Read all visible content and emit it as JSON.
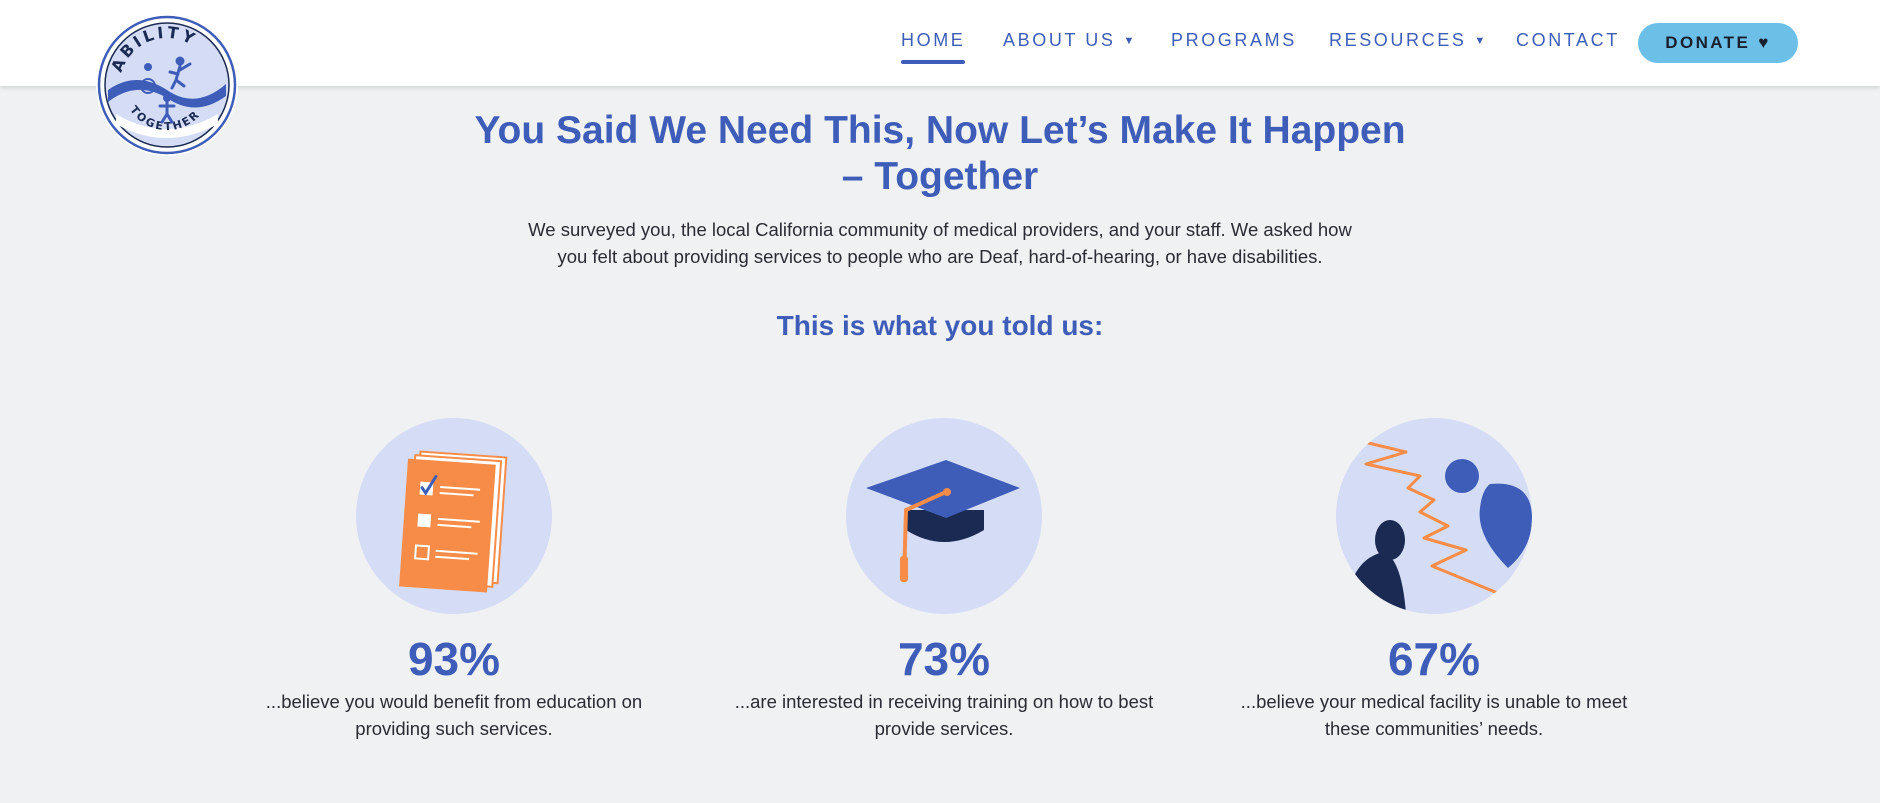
{
  "brand": {
    "logo_top_text": "ABILITY",
    "logo_bottom_text": "TOGETHER"
  },
  "nav": {
    "home": "HOME",
    "about": "ABOUT US",
    "programs": "PROGRAMS",
    "resources": "RESOURCES",
    "contact": "CONTACT",
    "donate": "DONATE"
  },
  "hero": {
    "title": "You Said We Need This, Now Let’s Make It Happen – Together",
    "intro": "We surveyed you, the local California community of medical providers, and your staff. We asked how you felt about providing services to people who are Deaf, hard-of-hearing, or have disabilities.",
    "subhead": "This is what you told us:"
  },
  "stats": [
    {
      "value": "93%",
      "description": "...believe you would benefit from education on providing such services.",
      "icon": "checklist-document-icon"
    },
    {
      "value": "73%",
      "description": "...are interested in receiving training on how to best provide services.",
      "icon": "graduation-cap-icon"
    },
    {
      "value": "67%",
      "description": "...believe your medical facility is unable to meet these communities’ needs.",
      "icon": "people-divide-icon"
    }
  ],
  "colors": {
    "primary": "#3d5db9",
    "accent_orange": "#f78c48",
    "donate_bg": "#6cc0e8",
    "circle_bg": "#d5ddf6",
    "navy": "#1b2a52",
    "page_bg": "#f0f1f3"
  }
}
